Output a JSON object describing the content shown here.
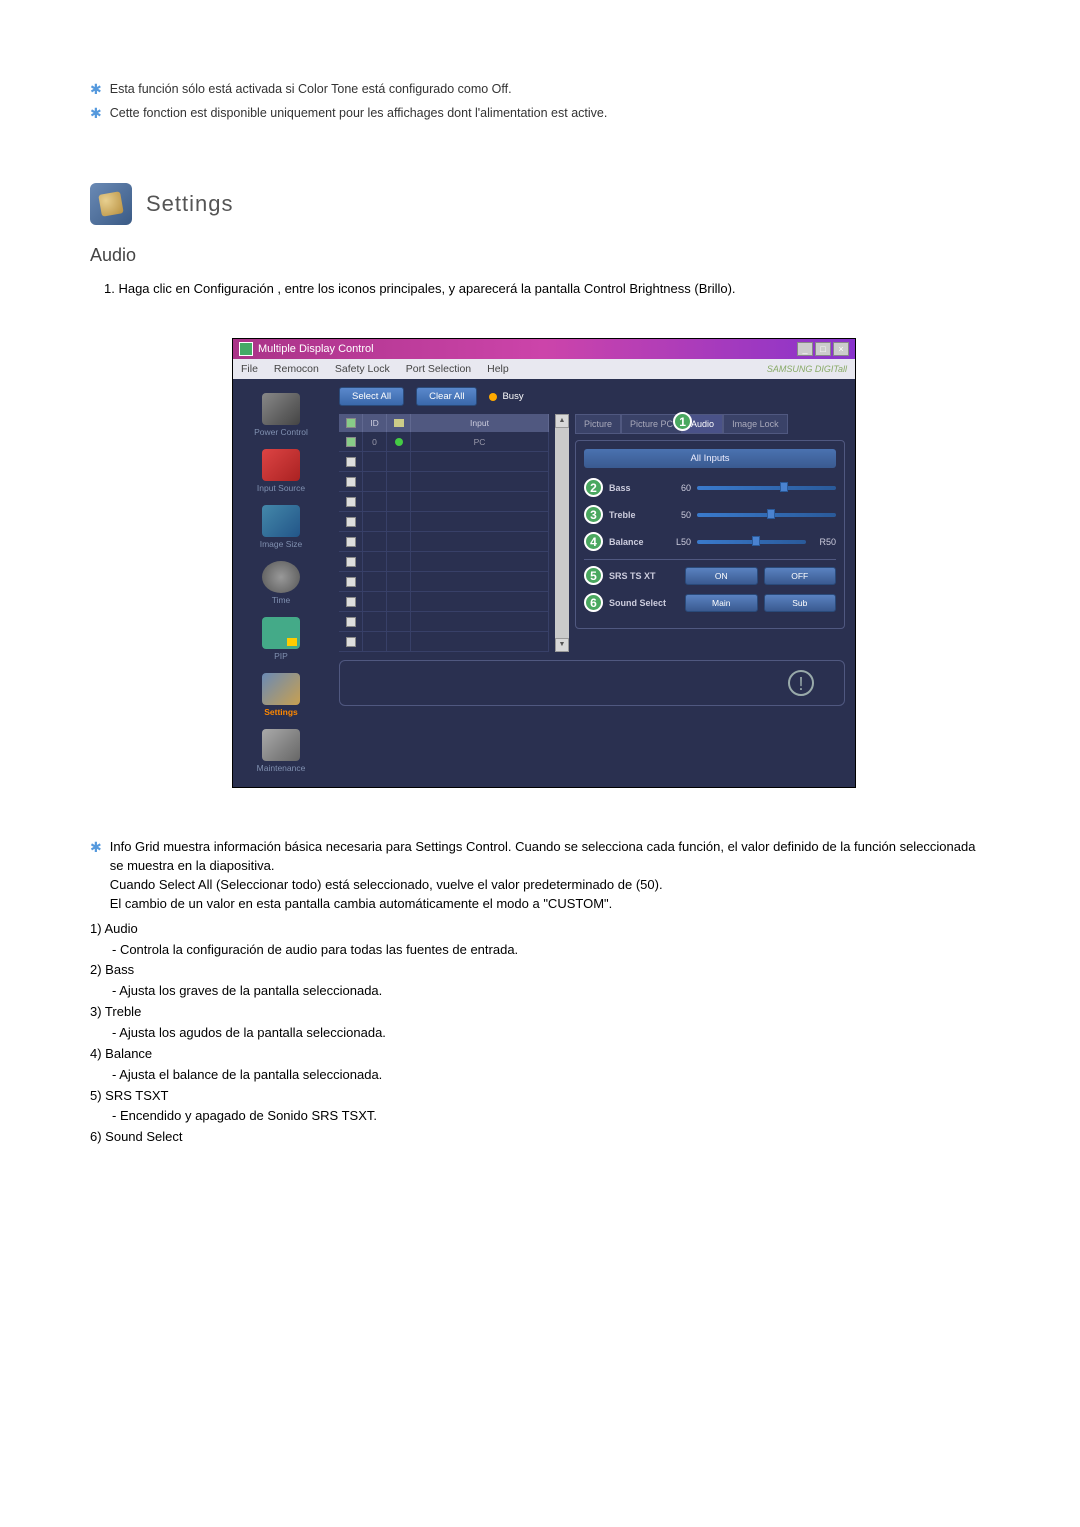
{
  "top_notes": [
    "Esta función sólo está activada si Color Tone está configurado como Off.",
    "Cette fonction est disponible uniquement pour les affichages dont l'alimentation est active."
  ],
  "section": {
    "title": "Settings"
  },
  "subsection": {
    "title": "Audio"
  },
  "intro_numbered": "1.  Haga clic en Configuración , entre los iconos principales, y aparecerá la pantalla Control Brightness (Brillo).",
  "app": {
    "title": "Multiple Display Control",
    "brand": "SAMSUNG DIGITall",
    "menu": [
      "File",
      "Remocon",
      "Safety Lock",
      "Port Selection",
      "Help"
    ],
    "sidebar": [
      {
        "label": "Power Control"
      },
      {
        "label": "Input Source"
      },
      {
        "label": "Image Size"
      },
      {
        "label": "Time"
      },
      {
        "label": "PIP"
      },
      {
        "label": "Settings"
      },
      {
        "label": "Maintenance"
      }
    ],
    "toolbar": {
      "select_all": "Select All",
      "clear_all": "Clear All",
      "busy": "Busy"
    },
    "grid": {
      "headers": {
        "chk": "",
        "id": "ID",
        "status": "",
        "input": "Input"
      },
      "rows": [
        {
          "checked": true,
          "id": "0",
          "status": "green",
          "input": "PC"
        },
        {
          "checked": false,
          "id": "",
          "status": "",
          "input": ""
        },
        {
          "checked": false,
          "id": "",
          "status": "",
          "input": ""
        },
        {
          "checked": false,
          "id": "",
          "status": "",
          "input": ""
        },
        {
          "checked": false,
          "id": "",
          "status": "",
          "input": ""
        },
        {
          "checked": false,
          "id": "",
          "status": "",
          "input": ""
        },
        {
          "checked": false,
          "id": "",
          "status": "",
          "input": ""
        },
        {
          "checked": false,
          "id": "",
          "status": "",
          "input": ""
        },
        {
          "checked": false,
          "id": "",
          "status": "",
          "input": ""
        },
        {
          "checked": false,
          "id": "",
          "status": "",
          "input": ""
        },
        {
          "checked": false,
          "id": "",
          "status": "",
          "input": ""
        }
      ]
    },
    "tabs": [
      "Picture",
      "Picture PC",
      "Audio",
      "Image Lock"
    ],
    "active_tab_callout": "1",
    "all_inputs": "All Inputs",
    "controls": {
      "bass": {
        "callout": "2",
        "label": "Bass",
        "value": "60",
        "pos": 60
      },
      "treble": {
        "callout": "3",
        "label": "Treble",
        "value": "50",
        "pos": 50
      },
      "balance": {
        "callout": "4",
        "label": "Balance",
        "left": "L50",
        "right": "R50",
        "pos": 50
      },
      "srs": {
        "callout": "5",
        "label": "SRS TS XT",
        "opt_on": "ON",
        "opt_off": "OFF"
      },
      "sound_select": {
        "callout": "6",
        "label": "Sound Select",
        "opt_main": "Main",
        "opt_sub": "Sub"
      }
    }
  },
  "desc": {
    "head": "Info Grid muestra información básica necesaria para Settings Control. Cuando se selecciona cada función, el valor definido de la función seleccionada se muestra en la diapositiva.",
    "line2": "Cuando Select All (Seleccionar todo) está seleccionado, vuelve el valor predeterminado de (50).",
    "line3": "El cambio de un valor en esta pantalla cambia automáticamente el modo a \"CUSTOM\".",
    "items": [
      {
        "n": "1)",
        "label": "Audio",
        "desc": "- Controla la configuración de audio para todas las fuentes de entrada."
      },
      {
        "n": "2)",
        "label": "Bass",
        "desc": "- Ajusta los graves de la pantalla seleccionada."
      },
      {
        "n": "3)",
        "label": "Treble",
        "desc": "- Ajusta los agudos de la pantalla seleccionada."
      },
      {
        "n": "4)",
        "label": "Balance",
        "desc": "- Ajusta el balance de la pantalla seleccionada."
      },
      {
        "n": "5)",
        "label": "SRS TSXT",
        "desc": "- Encendido y apagado de Sonido SRS TSXT."
      },
      {
        "n": "6)",
        "label": "Sound Select",
        "desc": ""
      }
    ]
  }
}
